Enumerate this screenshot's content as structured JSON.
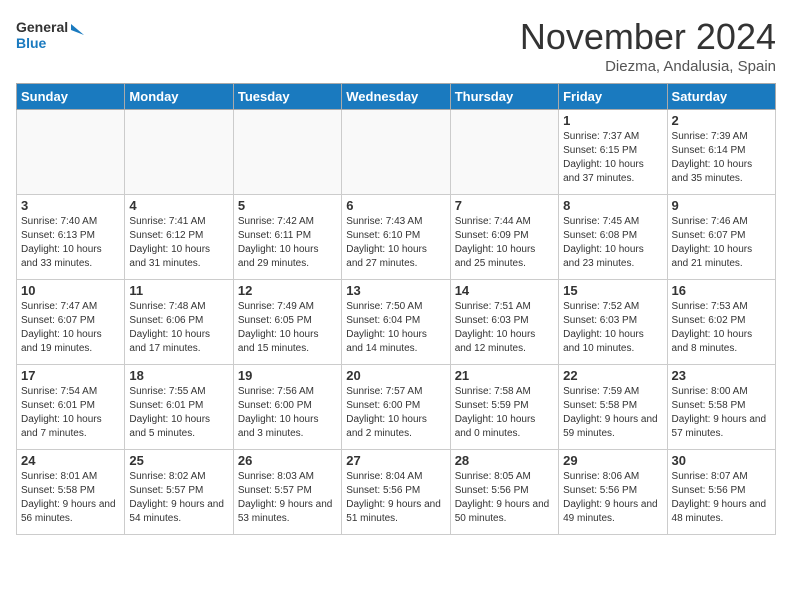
{
  "header": {
    "logo_line1": "General",
    "logo_line2": "Blue",
    "month": "November 2024",
    "location": "Diezma, Andalusia, Spain"
  },
  "weekdays": [
    "Sunday",
    "Monday",
    "Tuesday",
    "Wednesday",
    "Thursday",
    "Friday",
    "Saturday"
  ],
  "weeks": [
    [
      {
        "day": "",
        "info": ""
      },
      {
        "day": "",
        "info": ""
      },
      {
        "day": "",
        "info": ""
      },
      {
        "day": "",
        "info": ""
      },
      {
        "day": "",
        "info": ""
      },
      {
        "day": "1",
        "info": "Sunrise: 7:37 AM\nSunset: 6:15 PM\nDaylight: 10 hours and 37 minutes."
      },
      {
        "day": "2",
        "info": "Sunrise: 7:39 AM\nSunset: 6:14 PM\nDaylight: 10 hours and 35 minutes."
      }
    ],
    [
      {
        "day": "3",
        "info": "Sunrise: 7:40 AM\nSunset: 6:13 PM\nDaylight: 10 hours and 33 minutes."
      },
      {
        "day": "4",
        "info": "Sunrise: 7:41 AM\nSunset: 6:12 PM\nDaylight: 10 hours and 31 minutes."
      },
      {
        "day": "5",
        "info": "Sunrise: 7:42 AM\nSunset: 6:11 PM\nDaylight: 10 hours and 29 minutes."
      },
      {
        "day": "6",
        "info": "Sunrise: 7:43 AM\nSunset: 6:10 PM\nDaylight: 10 hours and 27 minutes."
      },
      {
        "day": "7",
        "info": "Sunrise: 7:44 AM\nSunset: 6:09 PM\nDaylight: 10 hours and 25 minutes."
      },
      {
        "day": "8",
        "info": "Sunrise: 7:45 AM\nSunset: 6:08 PM\nDaylight: 10 hours and 23 minutes."
      },
      {
        "day": "9",
        "info": "Sunrise: 7:46 AM\nSunset: 6:07 PM\nDaylight: 10 hours and 21 minutes."
      }
    ],
    [
      {
        "day": "10",
        "info": "Sunrise: 7:47 AM\nSunset: 6:07 PM\nDaylight: 10 hours and 19 minutes."
      },
      {
        "day": "11",
        "info": "Sunrise: 7:48 AM\nSunset: 6:06 PM\nDaylight: 10 hours and 17 minutes."
      },
      {
        "day": "12",
        "info": "Sunrise: 7:49 AM\nSunset: 6:05 PM\nDaylight: 10 hours and 15 minutes."
      },
      {
        "day": "13",
        "info": "Sunrise: 7:50 AM\nSunset: 6:04 PM\nDaylight: 10 hours and 14 minutes."
      },
      {
        "day": "14",
        "info": "Sunrise: 7:51 AM\nSunset: 6:03 PM\nDaylight: 10 hours and 12 minutes."
      },
      {
        "day": "15",
        "info": "Sunrise: 7:52 AM\nSunset: 6:03 PM\nDaylight: 10 hours and 10 minutes."
      },
      {
        "day": "16",
        "info": "Sunrise: 7:53 AM\nSunset: 6:02 PM\nDaylight: 10 hours and 8 minutes."
      }
    ],
    [
      {
        "day": "17",
        "info": "Sunrise: 7:54 AM\nSunset: 6:01 PM\nDaylight: 10 hours and 7 minutes."
      },
      {
        "day": "18",
        "info": "Sunrise: 7:55 AM\nSunset: 6:01 PM\nDaylight: 10 hours and 5 minutes."
      },
      {
        "day": "19",
        "info": "Sunrise: 7:56 AM\nSunset: 6:00 PM\nDaylight: 10 hours and 3 minutes."
      },
      {
        "day": "20",
        "info": "Sunrise: 7:57 AM\nSunset: 6:00 PM\nDaylight: 10 hours and 2 minutes."
      },
      {
        "day": "21",
        "info": "Sunrise: 7:58 AM\nSunset: 5:59 PM\nDaylight: 10 hours and 0 minutes."
      },
      {
        "day": "22",
        "info": "Sunrise: 7:59 AM\nSunset: 5:58 PM\nDaylight: 9 hours and 59 minutes."
      },
      {
        "day": "23",
        "info": "Sunrise: 8:00 AM\nSunset: 5:58 PM\nDaylight: 9 hours and 57 minutes."
      }
    ],
    [
      {
        "day": "24",
        "info": "Sunrise: 8:01 AM\nSunset: 5:58 PM\nDaylight: 9 hours and 56 minutes."
      },
      {
        "day": "25",
        "info": "Sunrise: 8:02 AM\nSunset: 5:57 PM\nDaylight: 9 hours and 54 minutes."
      },
      {
        "day": "26",
        "info": "Sunrise: 8:03 AM\nSunset: 5:57 PM\nDaylight: 9 hours and 53 minutes."
      },
      {
        "day": "27",
        "info": "Sunrise: 8:04 AM\nSunset: 5:56 PM\nDaylight: 9 hours and 51 minutes."
      },
      {
        "day": "28",
        "info": "Sunrise: 8:05 AM\nSunset: 5:56 PM\nDaylight: 9 hours and 50 minutes."
      },
      {
        "day": "29",
        "info": "Sunrise: 8:06 AM\nSunset: 5:56 PM\nDaylight: 9 hours and 49 minutes."
      },
      {
        "day": "30",
        "info": "Sunrise: 8:07 AM\nSunset: 5:56 PM\nDaylight: 9 hours and 48 minutes."
      }
    ]
  ]
}
